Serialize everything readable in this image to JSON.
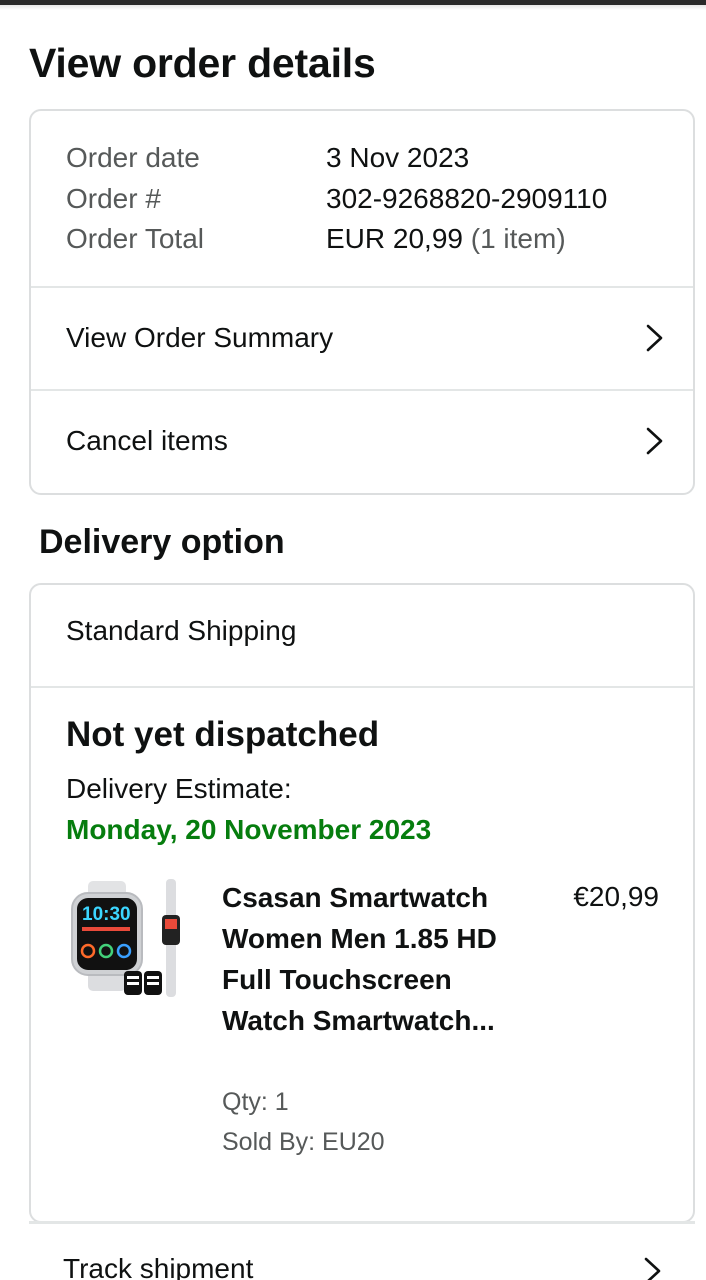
{
  "page": {
    "title": "View order details"
  },
  "order": {
    "date_label": "Order date",
    "date_value": "3 Nov 2023",
    "number_label": "Order #",
    "number_value": "302-9268820-2909110",
    "total_label": "Order Total",
    "total_value": "EUR 20,99",
    "total_items": "(1 item)",
    "summary_link": "View Order Summary",
    "cancel_link": "Cancel items"
  },
  "delivery": {
    "section_title": "Delivery option",
    "shipping_method": "Standard Shipping",
    "status": "Not yet dispatched",
    "estimate_label": "Delivery Estimate:",
    "estimate_date": "Monday, 20 November 2023",
    "estimate_color": "#067d0e"
  },
  "item": {
    "image_icon": "smartwatch-product-image",
    "title": "Csasan Smartwatch Women Men 1.85 HD Full Touchscreen Watch Smartwatch...",
    "price": "€20,99",
    "qty": "Qty: 1",
    "sold_by": "Sold By: EU20",
    "watch_time": "10:30"
  },
  "actions": {
    "track_label": "Track shipment"
  },
  "icons": {
    "chevron": "chevron-right-icon"
  }
}
